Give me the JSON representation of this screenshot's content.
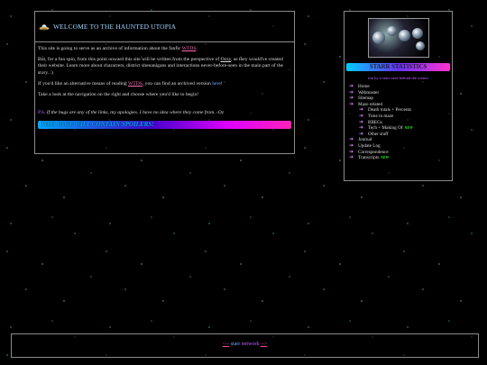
{
  "main": {
    "title": "WELCOME TO THE HAUNTED UTOPIA",
    "intro_before": "This site is going to serve as an archive of information about the fanfic ",
    "fanfic_link": "WTDS",
    "intro_after": ".",
    "para2_before": "But, for a fun spin, from this point onward this site will be written from the perspective of ",
    "author_link": "Ozzy",
    "para2_after": ", as they would've created their website. Learn more about characters, district shenanigans and interactions never-before-seen in the main part of the story. :)",
    "para3_before": "If you'd like an alternative means of reading ",
    "para3_link": "WTDS",
    "para3_mid": ", you can find an archived version ",
    "para3_here": "here",
    "para3_after": "!",
    "para4": "Take a look at the navigation on the right and choose where you'd like to begin!",
    "ps_label": "P.S.",
    "ps_text": " If the bugs are any of the links, my apologies. I have no idea where they come from. -Oz",
    "spoiler": "THIS PAGE WILL CONTAIN SPOILERS!"
  },
  "sidebar": {
    "stats_title": "STARR STATISTICS",
    "tagline": "run by a stats nerd behind the scenes",
    "nav": [
      {
        "label": "Home",
        "sub": false,
        "new": ""
      },
      {
        "label": "Webmaster",
        "sub": false,
        "new": ""
      },
      {
        "label": "Sitemap",
        "sub": false,
        "new": ""
      },
      {
        "label": "Maze related",
        "sub": false,
        "new": ""
      },
      {
        "label": "Death totals + Percents",
        "sub": true,
        "new": ""
      },
      {
        "label": "Time in maze",
        "sub": true,
        "new": ""
      },
      {
        "label": "BBEGs",
        "sub": true,
        "new": ""
      },
      {
        "label": "Tech + Making Of",
        "sub": true,
        "new": "NEW"
      },
      {
        "label": "Other stuff",
        "sub": true,
        "new": ""
      },
      {
        "label": "Journal",
        "sub": false,
        "new": ""
      },
      {
        "label": "Update Log",
        "sub": false,
        "new": ""
      },
      {
        "label": "Correspondence",
        "sub": false,
        "new": ""
      },
      {
        "label": "Transcripts",
        "sub": false,
        "new": "NEW"
      }
    ]
  },
  "footer": {
    "prev": "<--",
    "word1": "starr",
    "word2": "network",
    "next": "-->"
  },
  "icons": {
    "header_icon": "ufo-icon",
    "nav_arrow": "arrow-right-icon"
  },
  "colors": {
    "link_pink": "#ff69b4",
    "link_blue": "#6fa8ff",
    "accent_purple": "#c060ff",
    "new_badge": "#22ff22"
  }
}
